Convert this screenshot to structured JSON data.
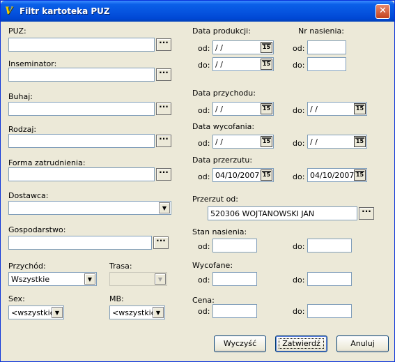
{
  "window": {
    "title": "Filtr kartoteka PUZ",
    "icon": "app-logo-icon",
    "close_glyph": "✕"
  },
  "left": {
    "puz": {
      "label": "PUZ:",
      "value": "",
      "lookup": "···"
    },
    "inseminator": {
      "label": "Inseminator:",
      "value": "",
      "lookup": "···"
    },
    "buhaj": {
      "label": "Buhaj:",
      "value": "",
      "lookup": "···"
    },
    "rodzaj": {
      "label": "Rodzaj:",
      "value": "",
      "lookup": "···"
    },
    "forma": {
      "label": "Forma zatrudnienia:",
      "value": "",
      "lookup": "···"
    },
    "dostawca": {
      "label": "Dostawca:",
      "value": ""
    },
    "gospodarstwo": {
      "label": "Gospodarstwo:",
      "value": "",
      "lookup": "···"
    },
    "przychod": {
      "label": "Przychód:",
      "value": "Wszystkie"
    },
    "trasa": {
      "label": "Trasa:",
      "value": ""
    },
    "sex": {
      "label": "Sex:",
      "value": "<wszystkie>"
    },
    "mb": {
      "label": "MB:",
      "value": "<wszystkie>"
    }
  },
  "right": {
    "data_produkcji": {
      "label": "Data produkcji:",
      "od_label": "od:",
      "do_label": "do:",
      "od_value": " / /",
      "do_value": " / /"
    },
    "nr_nasienia": {
      "label": "Nr nasienia:",
      "od_label": "od:",
      "do_label": "do:",
      "od_value": "",
      "do_value": ""
    },
    "data_przychodu": {
      "label": "Data przychodu:",
      "od_label": "od:",
      "do_label": "do:",
      "od_value": " / /",
      "do_value": " / /"
    },
    "data_wycofania": {
      "label": "Data wycofania:",
      "od_label": "od:",
      "do_label": "do:",
      "od_value": " / /",
      "do_value": " / /"
    },
    "data_przerzutu": {
      "label": "Data przerzutu:",
      "od_label": "od:",
      "do_label": "do:",
      "od_value": "04/10/2007",
      "do_value": "04/10/2007"
    },
    "przerzut_od": {
      "label": "Przerzut od:",
      "value": "520306 WOJTANOWSKI JAN",
      "lookup": "···"
    },
    "stan_nasienia": {
      "label": "Stan nasienia:",
      "od_label": "od:",
      "do_label": "do:",
      "od_value": "",
      "do_value": ""
    },
    "wycofane": {
      "label": "Wycofane:",
      "od_label": "od:",
      "do_label": "do:",
      "od_value": "",
      "do_value": ""
    },
    "cena": {
      "label": "Cena:",
      "od_label": "od:",
      "do_label": "do:",
      "od_value": "",
      "do_value": ""
    },
    "calendar_glyph": "15"
  },
  "buttons": {
    "clear": "Wyczyść",
    "confirm": "Zatwierdź",
    "cancel": "Anuluj"
  }
}
